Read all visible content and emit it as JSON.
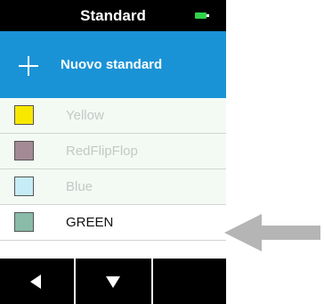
{
  "header": {
    "title": "Standard",
    "battery_icon": "battery-icon",
    "battery_color": "#2fd34a"
  },
  "add_bar": {
    "icon": "plus-icon",
    "label": "Nuovo standard",
    "color": "#1a93d6"
  },
  "standards": [
    {
      "name": "Yellow",
      "swatch": "#f8e800",
      "selected": false
    },
    {
      "name": "RedFlipFlop",
      "swatch": "#a48a94",
      "selected": false
    },
    {
      "name": "Blue",
      "swatch": "#c6ecf8",
      "selected": false
    },
    {
      "name": "GREEN",
      "swatch": "#8abba8",
      "selected": true
    }
  ],
  "nav": {
    "buttons": [
      "left-arrow-icon",
      "down-arrow-icon",
      "blank"
    ]
  },
  "annotation": {
    "icon": "pointer-arrow-icon",
    "color": "#b5b5b5"
  }
}
